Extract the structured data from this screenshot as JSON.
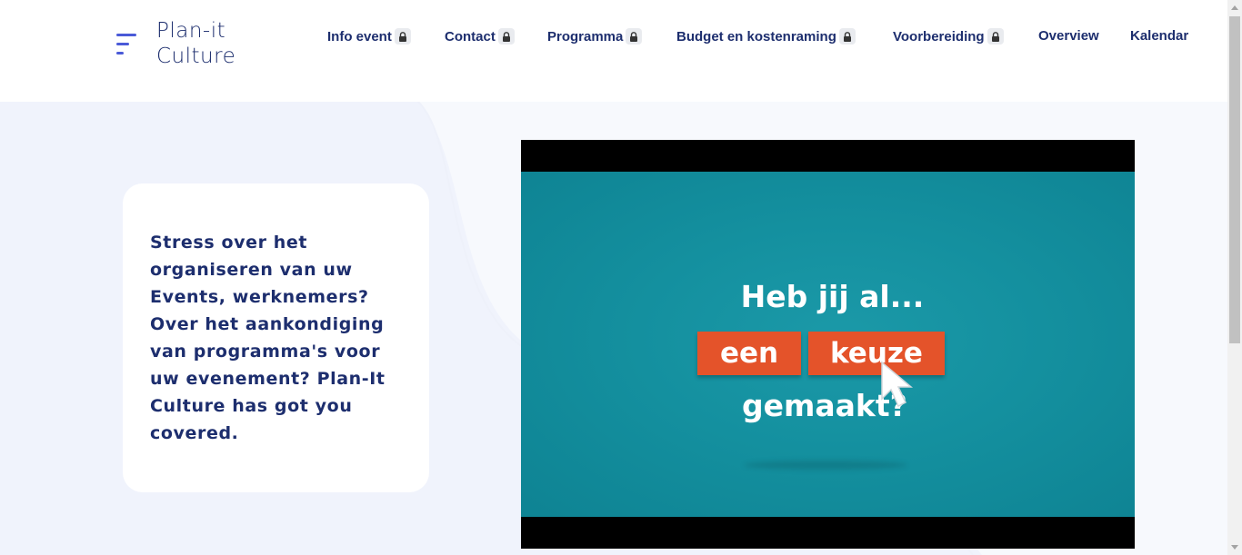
{
  "brand": {
    "line1": "Plan-it",
    "line2": "Culture"
  },
  "nav": {
    "items": [
      {
        "label": "Info event",
        "locked": true
      },
      {
        "label": "Contact",
        "locked": true
      },
      {
        "label": "Programma",
        "locked": true
      },
      {
        "label": "Budget en kostenraming",
        "locked": true
      },
      {
        "label": "Voorbereiding",
        "locked": true
      },
      {
        "label": "Overview",
        "locked": false
      },
      {
        "label": "Kalendar",
        "locked": false
      }
    ]
  },
  "hero": {
    "text": "Stress over het organiseren van uw Events, werknemers? Over het aankondiging van programma's voor uw evenement? Plan-It Culture has got you covered."
  },
  "video": {
    "line1": "Heb jij al...",
    "button1": "een",
    "button2": "keuze",
    "line3": "gemaakt?"
  },
  "colors": {
    "brand_navy": "#1d2e6e",
    "accent_blue": "#4a5ad8",
    "hero_bg": "#f0f3fc",
    "video_teal": "#14909f",
    "video_orange": "#e4532a"
  },
  "icons": {
    "menu": "hamburger-menu-icon",
    "lock": "lock-icon",
    "cursor": "mouse-pointer-icon"
  }
}
